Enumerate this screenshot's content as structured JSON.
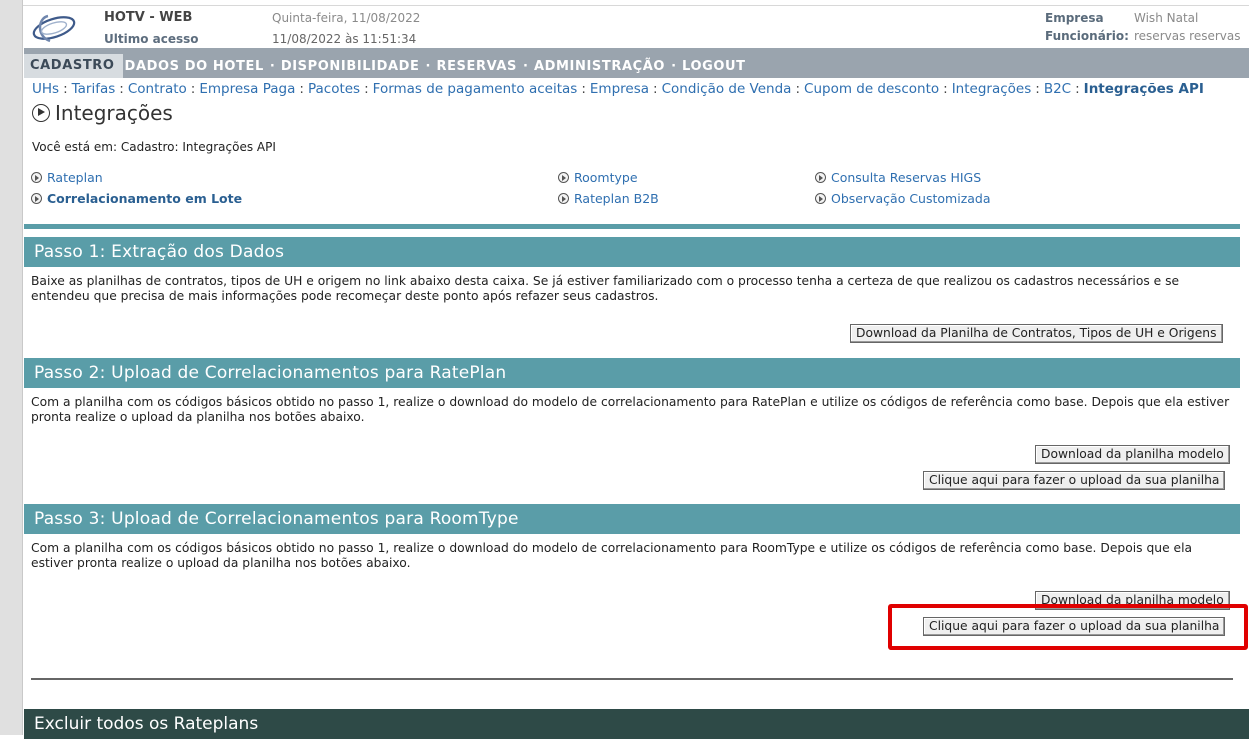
{
  "header": {
    "app_name": "HOTV - WEB",
    "last_access_label": "Ultimo acesso",
    "date": "Quinta-feira, 11/08/2022",
    "last_access_datetime": "11/08/2022  às  11:51:34",
    "empresa_label": "Empresa",
    "empresa_value": "Wish Natal",
    "funcionario_label": "Funcionário:",
    "funcionario_value": "reservas reservas"
  },
  "topnav": {
    "active": "CADASTRO",
    "items": [
      "DADOS DO HOTEL",
      "DISPONIBILIDADE",
      "RESERVAS",
      "ADMINISTRAÇÃO",
      "LOGOUT"
    ],
    "separator": "·"
  },
  "subnav": {
    "items": [
      "UHs",
      "Tarifas",
      "Contrato",
      "Empresa Paga",
      "Pacotes",
      "Formas de pagamento aceitas",
      "Empresa",
      "Condição de Venda",
      "Cupom de desconto",
      "Integrações",
      "B2C"
    ],
    "current": "Integrações API",
    "separator": ":"
  },
  "page_title": "Integrações",
  "breadcrumb": "Você está em: Cadastro: Integrações API",
  "quicklinks": {
    "rateplan": "Rateplan",
    "correlacionamento_lote": "Correlacionamento em Lote",
    "roomtype": "Roomtype",
    "rateplan_b2b": "Rateplan B2B",
    "consulta_reservas": "Consulta Reservas HIGS",
    "observacao": "Observação Customizada"
  },
  "step1": {
    "title": "Passo 1: Extração dos Dados",
    "text": "Baixe as planilhas de contratos, tipos de UH e origem no link abaixo desta caixa. Se já estiver familiarizado com o processo tenha a certeza de que realizou os cadastros necessários e se entendeu que precisa de mais informações pode recomeçar deste ponto após refazer seus cadastros.",
    "download_button": "Download da Planilha de Contratos, Tipos de UH e Origens"
  },
  "step2": {
    "title": "Passo 2: Upload de Correlacionamentos para RatePlan",
    "text": "Com a planilha com os códigos básicos obtido no passo 1, realize o download do modelo de correlacionamento para RatePlan e utilize os códigos de referência como base. Depois que ela estiver pronta realize o upload da planilha nos botões abaixo.",
    "download_button": "Download da planilha modelo",
    "upload_button": "Clique aqui para fazer o upload da sua planilha"
  },
  "step3": {
    "title": "Passo 3: Upload de Correlacionamentos para RoomType",
    "text": "Com a planilha com os códigos básicos obtido no passo 1, realize o download do modelo de correlacionamento para RoomType e utilize os códigos de referência como base. Depois que ela estiver pronta realize o upload da planilha nos botões abaixo.",
    "download_button": "Download da planilha modelo",
    "upload_button": "Clique aqui para fazer o upload da sua planilha"
  },
  "delete_section": {
    "title": "Excluir todos os Rateplans"
  },
  "colors": {
    "section_teal": "#5a9da8",
    "nav_gray": "#9aa4ae",
    "dark_section": "#2e4a47",
    "highlight_red": "#e00000",
    "link_blue": "#2f6fb0"
  }
}
